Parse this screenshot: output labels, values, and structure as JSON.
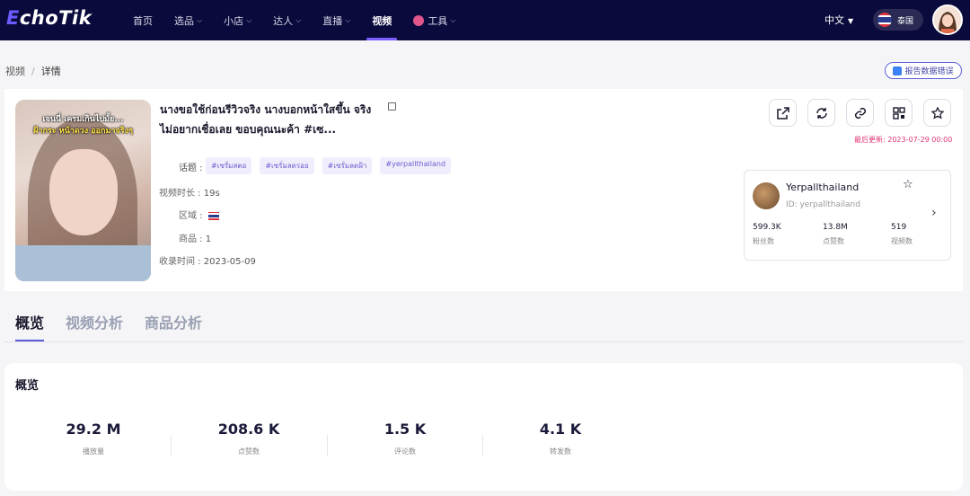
{
  "nav": {
    "logo_prefix": "E",
    "logo_rest": "choTik",
    "items": [
      {
        "label": "首页",
        "has_dropdown": false
      },
      {
        "label": "选品",
        "has_dropdown": true
      },
      {
        "label": "小店",
        "has_dropdown": true
      },
      {
        "label": "达人",
        "has_dropdown": true
      },
      {
        "label": "直播",
        "has_dropdown": true
      },
      {
        "label": "视频",
        "has_dropdown": false,
        "active": true
      },
      {
        "label": "工具",
        "has_dropdown": true,
        "icon": "tool-icon"
      }
    ],
    "language": "中文",
    "region": "泰国"
  },
  "breadcrumb": {
    "parent": "视频",
    "separator": "/",
    "current": "详情"
  },
  "report_button": "报告数据错误",
  "video": {
    "thumbnail_caption_line1": "เจนนี่ เครมเกินไปมั้ย...",
    "thumbnail_caption_line2": "ฝ้ากระ หน้าดวง ออกมาจริงๆ",
    "title": "นางขอใช้ก่อนรีวิวจริง นางบอกหน้าใสขึ้น จริงไม่อยากเชื่อเลย ขอบคุณนะค้า #เซ...",
    "topics_label": "话题 :",
    "tags": [
      "#เซรั่มสตอ",
      "#เซรั่มลดรอย",
      "#เซรั่มลดฝ้า",
      "#yerpallthailand"
    ],
    "duration_label": "视频时长 :",
    "duration": "19s",
    "region_label": "区域 :",
    "products_label": "商品 :",
    "products": "1",
    "collected_label": "收录时间 :",
    "collected": "2023-05-09",
    "updated_label": "最后更新:",
    "updated": "2023-07-29 00:00"
  },
  "actions": [
    "share-icon",
    "refresh-icon",
    "link-icon",
    "qrcode-icon",
    "star-icon"
  ],
  "author": {
    "name": "Yerpallthailand",
    "id": "ID: yerpallthailand",
    "stats": [
      {
        "value": "599.3K",
        "label": "粉丝数"
      },
      {
        "value": "13.8M",
        "label": "点赞数"
      },
      {
        "value": "519",
        "label": "视频数"
      }
    ]
  },
  "tabs": [
    {
      "label": "概览",
      "active": true
    },
    {
      "label": "视频分析",
      "active": false
    },
    {
      "label": "商品分析",
      "active": false
    }
  ],
  "overview": {
    "heading": "概览",
    "stats": [
      {
        "value": "29.2 M",
        "label": "播放量"
      },
      {
        "value": "208.6 K",
        "label": "点赞数"
      },
      {
        "value": "1.5 K",
        "label": "评论数"
      },
      {
        "value": "4.1 K",
        "label": "转发数"
      }
    ]
  },
  "colors": {
    "nav_bg": "#0a0a3c",
    "accent": "#5b5ed6",
    "updated": "#e0367a"
  }
}
